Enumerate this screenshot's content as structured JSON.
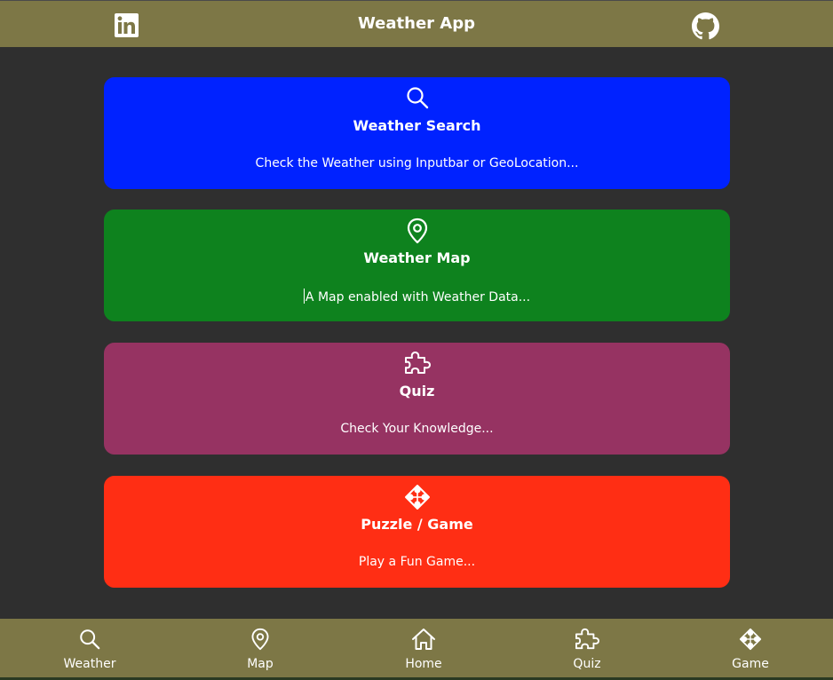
{
  "header": {
    "title": "Weather App",
    "left_icon": "linkedin-icon",
    "right_icon": "github-icon"
  },
  "cards": [
    {
      "icon": "search-icon",
      "title": "Weather Search",
      "description": "Check the Weather using Inputbar or GeoLocation...",
      "color": "#0022ff"
    },
    {
      "icon": "map-pin-icon",
      "title": "Weather Map",
      "description": "A Map enabled with Weather Data...",
      "color": "#0e821e"
    },
    {
      "icon": "puzzle-icon",
      "title": "Quiz",
      "description": "Check Your Knowledge...",
      "color": "#963362"
    },
    {
      "icon": "gamepad-icon",
      "title": "Puzzle / Game",
      "description": "Play a Fun Game...",
      "color": "#ff2e14"
    }
  ],
  "bottom_nav": [
    {
      "icon": "search-icon",
      "label": "Weather"
    },
    {
      "icon": "map-pin-icon",
      "label": "Map"
    },
    {
      "icon": "home-icon",
      "label": "Home"
    },
    {
      "icon": "puzzle-icon",
      "label": "Quiz"
    },
    {
      "icon": "gamepad-icon",
      "label": "Game"
    }
  ],
  "colors": {
    "background": "#2f2f2f",
    "bars": "#7d7746",
    "text": "#ffffff"
  }
}
